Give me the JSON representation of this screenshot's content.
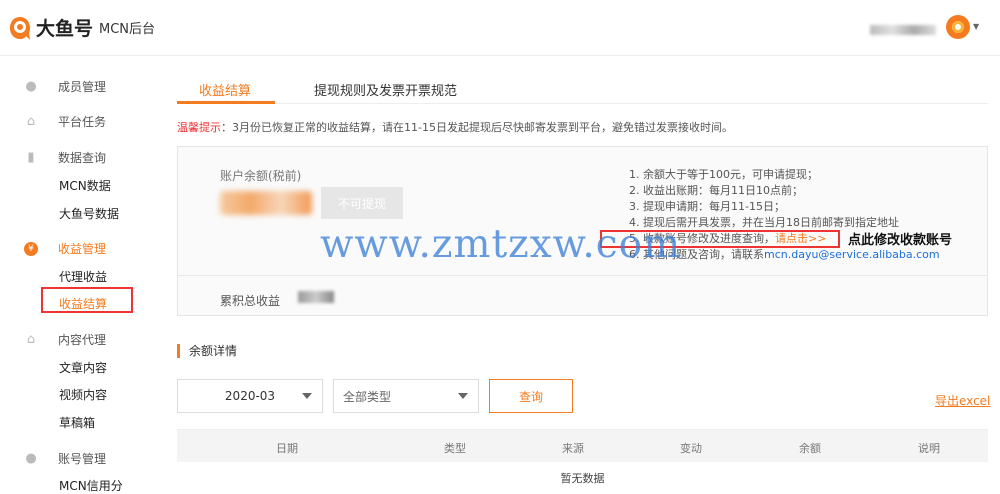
{
  "header": {
    "logo_text": "大鱼号",
    "logo_sub": "MCN后台"
  },
  "sidebar": {
    "groups": [
      {
        "label": "成员管理",
        "icon": "person-icon"
      },
      {
        "label": "平台任务",
        "icon": "home-icon"
      },
      {
        "label": "数据查询",
        "icon": "bar-chart-icon"
      },
      {
        "label": "收益管理",
        "icon": "yuan-icon"
      },
      {
        "label": "内容代理",
        "icon": "home-icon"
      },
      {
        "label": "账号管理",
        "icon": "person-icon"
      }
    ],
    "items": {
      "mcn_data": "MCN数据",
      "dayu_data": "大鱼号数据",
      "agent_income": "代理收益",
      "income_settle": "收益结算",
      "articles": "文章内容",
      "videos": "视频内容",
      "drafts": "草稿箱",
      "mcn_credit": "MCN信用分"
    },
    "yuan_glyph": "¥"
  },
  "tabs": {
    "active": "收益结算",
    "second": "提现规则及发票开票规范"
  },
  "notice": {
    "label": "温馨提示",
    "text": "：3月份已恢复正常的收益结算，请在11-15日发起提现后尽快邮寄发票到平台，避免错过发票接收时间。"
  },
  "account": {
    "balance_label": "账户余额(税前)",
    "withdraw_button": "不可提现",
    "cumulative_label": "累积总收益",
    "rules": [
      "1. 余额大于等于100元，可申请提现；",
      "2. 收益出账期：每月11日10点前；",
      "3. 提现申请期：每月11-15日；",
      "4. 提现后需开具发票，并在当月18日前邮寄到指定地址"
    ],
    "rule5_text": "5. 收款账号修改及进度查询，",
    "rule5_link": "请点击>>",
    "rule6_text": "6. 其他问题及咨询，请联系",
    "rule6_mail": "mcn.dayu@service.alibaba.com"
  },
  "annotation": {
    "callout": "点此修改收款账号",
    "watermark": "www.zmtzxw.com"
  },
  "balance_section": {
    "title": "余额详情"
  },
  "filters": {
    "month": "2020-03",
    "type": "全部类型",
    "query_button": "查询",
    "export_link": "导出excel"
  },
  "table": {
    "columns": [
      "日期",
      "类型",
      "来源",
      "变动",
      "余额",
      "说明"
    ],
    "empty_text": "暂无数据"
  },
  "colors": {
    "accent": "#f47b20",
    "highlight_border": "#e33333",
    "link_blue": "#1a6fd6"
  }
}
